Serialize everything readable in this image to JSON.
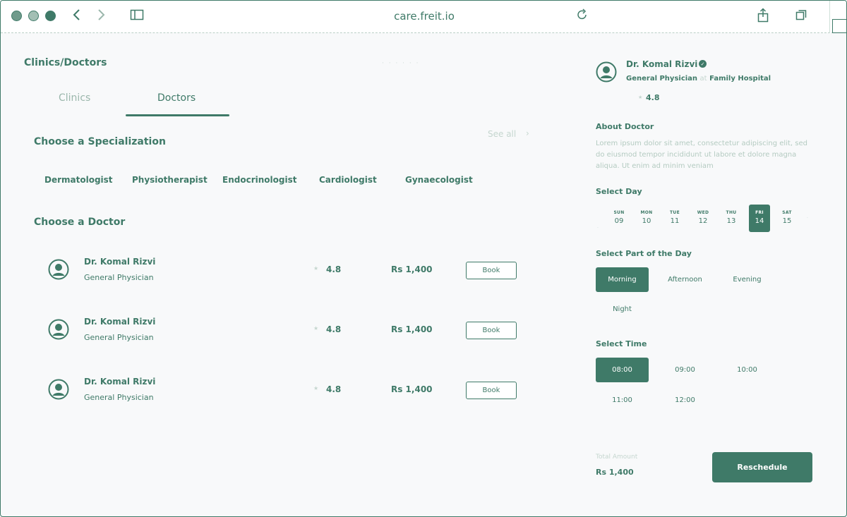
{
  "browser": {
    "url": "care.freit.io"
  },
  "page": {
    "title": "Clinics/Doctors",
    "tabs": [
      {
        "label": "Clinics",
        "active": false
      },
      {
        "label": "Doctors",
        "active": true
      }
    ]
  },
  "specialization": {
    "title": "Choose a Specialization",
    "see_all": "See all",
    "items": [
      "Dermatologist",
      "Physiotherapist",
      "Endocrinologist",
      "Cardiologist",
      "Gynaecologist"
    ]
  },
  "doctors": {
    "title": "Choose a Doctor",
    "list": [
      {
        "name": "Dr. Komal Rizvi",
        "specialty": "General Physician",
        "rating": "4.8",
        "price": "Rs 1,400",
        "button": "Book"
      },
      {
        "name": "Dr. Komal Rizvi",
        "specialty": "General Physician",
        "rating": "4.8",
        "price": "Rs 1,400",
        "button": "Book"
      },
      {
        "name": "Dr. Komal Rizvi",
        "specialty": "General Physician",
        "rating": "4.8",
        "price": "Rs 1,400",
        "button": "Book"
      }
    ]
  },
  "detail": {
    "name": "Dr. Komal Rizvi",
    "specialty": "General Physician",
    "separator": "at",
    "hospital": "Family Hospital",
    "rating": "4.8",
    "about_title": "About Doctor",
    "about_text": "Lorem ipsum dolor sit amet, consectetur adipiscing elit, sed do eiusmod tempor incididunt ut labore et dolore magna aliqua. Ut enim ad minim veniam",
    "select_day_title": "Select Day",
    "days": [
      {
        "name": "SUN",
        "num": "09"
      },
      {
        "name": "MON",
        "num": "10"
      },
      {
        "name": "TUE",
        "num": "11"
      },
      {
        "name": "WED",
        "num": "12"
      },
      {
        "name": "THU",
        "num": "13"
      },
      {
        "name": "FRI",
        "num": "14"
      },
      {
        "name": "SAT",
        "num": "15"
      }
    ],
    "selected_day_index": 5,
    "part_title": "Select Part of the Day",
    "parts": [
      "Morning",
      "Afternoon",
      "Evening",
      "Night"
    ],
    "selected_part_index": 0,
    "time_title": "Select Time",
    "times": [
      "08:00",
      "09:00",
      "10:00",
      "11:00",
      "12:00"
    ],
    "selected_time_index": 0,
    "total_label": "Total Amount",
    "total_value": "Rs 1,400",
    "reschedule_label": "Reschedule"
  },
  "colors": {
    "primary": "#3f7a68",
    "muted": "#c5d6cf",
    "background": "#f8f9fa"
  }
}
